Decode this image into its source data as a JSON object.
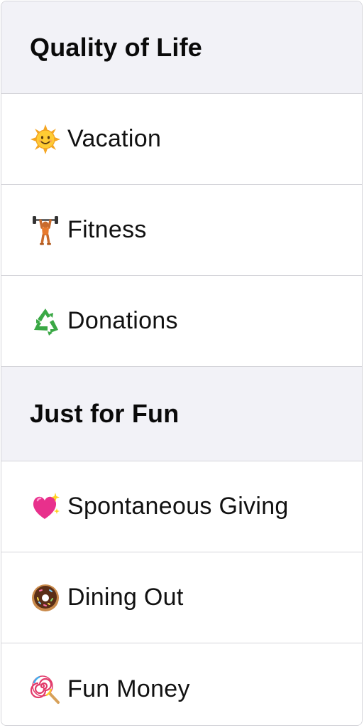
{
  "sections": [
    {
      "title": "Quality of Life",
      "items": [
        {
          "icon": "sun-with-face-icon",
          "label": "Vacation"
        },
        {
          "icon": "person-lifting-weights-icon",
          "label": "Fitness"
        },
        {
          "icon": "recycling-symbol-icon",
          "label": "Donations"
        }
      ]
    },
    {
      "title": "Just for Fun",
      "items": [
        {
          "icon": "sparkling-heart-icon",
          "label": "Spontaneous Giving"
        },
        {
          "icon": "doughnut-icon",
          "label": "Dining Out"
        },
        {
          "icon": "lollipop-icon",
          "label": "Fun Money"
        }
      ]
    }
  ],
  "colors": {
    "header_background": "#f2f2f7",
    "divider": "#d5d5da",
    "text": "#111111"
  }
}
